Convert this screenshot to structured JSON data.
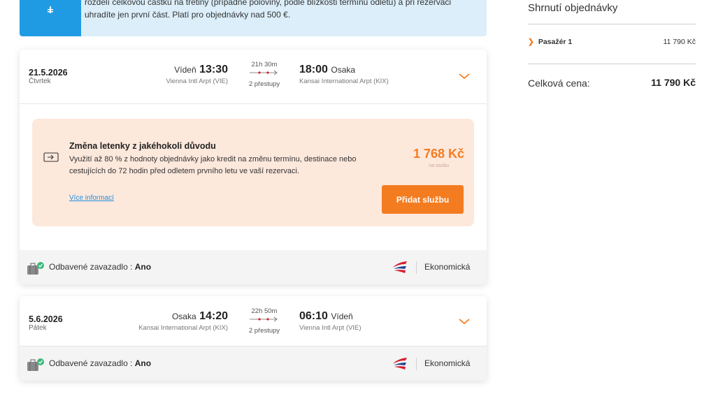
{
  "banner": {
    "text": "rozdělí celkovou částku na třetiny (případně poloviny, podle blízkosti termínu odletu) a při rezervaci uhradíte jen první část. Platí pro objednávky nad 500 €.",
    "icon": "info-icon"
  },
  "flights": [
    {
      "date": "21.5.2026",
      "day": "Čtvrtek",
      "dep_city": "Vídeň",
      "dep_time": "13:30",
      "dep_airport": "Vienna Intl Arpt (VIE)",
      "duration": "21h 30m",
      "stops": "2 přestupy",
      "arr_time": "18:00",
      "arr_city": "Osaka",
      "arr_airport": "Kansai International Arpt (KIX)",
      "baggage_label": "Odbavené zavazadlo : ",
      "baggage_value": "Ano",
      "cabin": "Ekonomická"
    },
    {
      "date": "5.6.2026",
      "day": "Pátek",
      "dep_city": "Osaka",
      "dep_time": "14:20",
      "dep_airport": "Kansai International Arpt (KIX)",
      "duration": "22h 50m",
      "stops": "2 přestupy",
      "arr_time": "06:10",
      "arr_city": "Vídeň",
      "arr_airport": "Vienna Intl Arpt (VIE)",
      "baggage_label": "Odbavené zavazadlo : ",
      "baggage_value": "Ano",
      "cabin": "Ekonomická"
    }
  ],
  "offer": {
    "title": "Změna letenky z jakéhokoli důvodu",
    "description": "Využití až 80 % z hodnoty objednávky jako kredit na změnu termínu, destinace nebo cestujících do 72 hodin před odletem prvního letu ve vaší rezervaci.",
    "price": "1 768 Kč",
    "per_person": "na osobu",
    "more_info": "Více informací",
    "button": "Přidat službu"
  },
  "summary": {
    "title": "Shrnutí objednávky",
    "passenger": "Pasažér 1",
    "passenger_price": "11 790 Kč",
    "total_label": "Celková cena:",
    "total_value": "11 790 Kč"
  },
  "colors": {
    "accent": "#f47c20",
    "banner_bg": "#dbeef9",
    "banner_side": "#1e9be3",
    "offer_bg": "#fde8dc",
    "link": "#1e8ee0",
    "airline_red": "#d81e2c",
    "airline_blue": "#1d3f8f"
  }
}
